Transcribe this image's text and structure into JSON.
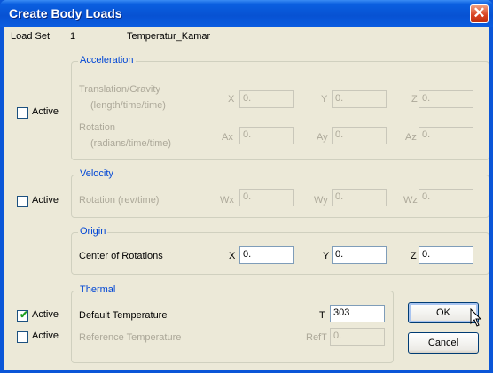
{
  "window": {
    "title": "Create Body Loads",
    "close_icon": "✕"
  },
  "load_set": {
    "label": "Load Set",
    "number": "1",
    "name": "Temperatur_Kamar"
  },
  "acceleration": {
    "legend": "Acceleration",
    "active_label": "Active",
    "translation_label1": "Translation/Gravity",
    "translation_label2": "(length/time/time)",
    "rotation_label1": "Rotation",
    "rotation_label2": "(radians/time/time)",
    "x_label": "X",
    "x_value": "0.",
    "y_label": "Y",
    "y_value": "0.",
    "z_label": "Z",
    "z_value": "0.",
    "ax_label": "Ax",
    "ax_value": "0.",
    "ay_label": "Ay",
    "ay_value": "0.",
    "az_label": "Az",
    "az_value": "0."
  },
  "velocity": {
    "legend": "Velocity",
    "active_label": "Active",
    "rotation_label": "Rotation (rev/time)",
    "wx_label": "Wx",
    "wx_value": "0.",
    "wy_label": "Wy",
    "wy_value": "0.",
    "wz_label": "Wz",
    "wz_value": "0."
  },
  "origin": {
    "legend": "Origin",
    "center_label": "Center of Rotations",
    "x_label": "X",
    "x_value": "0.",
    "y_label": "Y",
    "y_value": "0.",
    "z_label": "Z",
    "z_value": "0."
  },
  "thermal": {
    "legend": "Thermal",
    "active1_label": "Active",
    "active2_label": "Active",
    "default_label": "Default Temperature",
    "t_label": "T",
    "t_value": "303",
    "reference_label": "Reference Temperature",
    "reft_label": "RefT",
    "reft_value": "0."
  },
  "buttons": {
    "ok": "OK",
    "cancel": "Cancel"
  },
  "checkmark": "✔",
  "cursor_icon": "arrow-pointer-icon"
}
